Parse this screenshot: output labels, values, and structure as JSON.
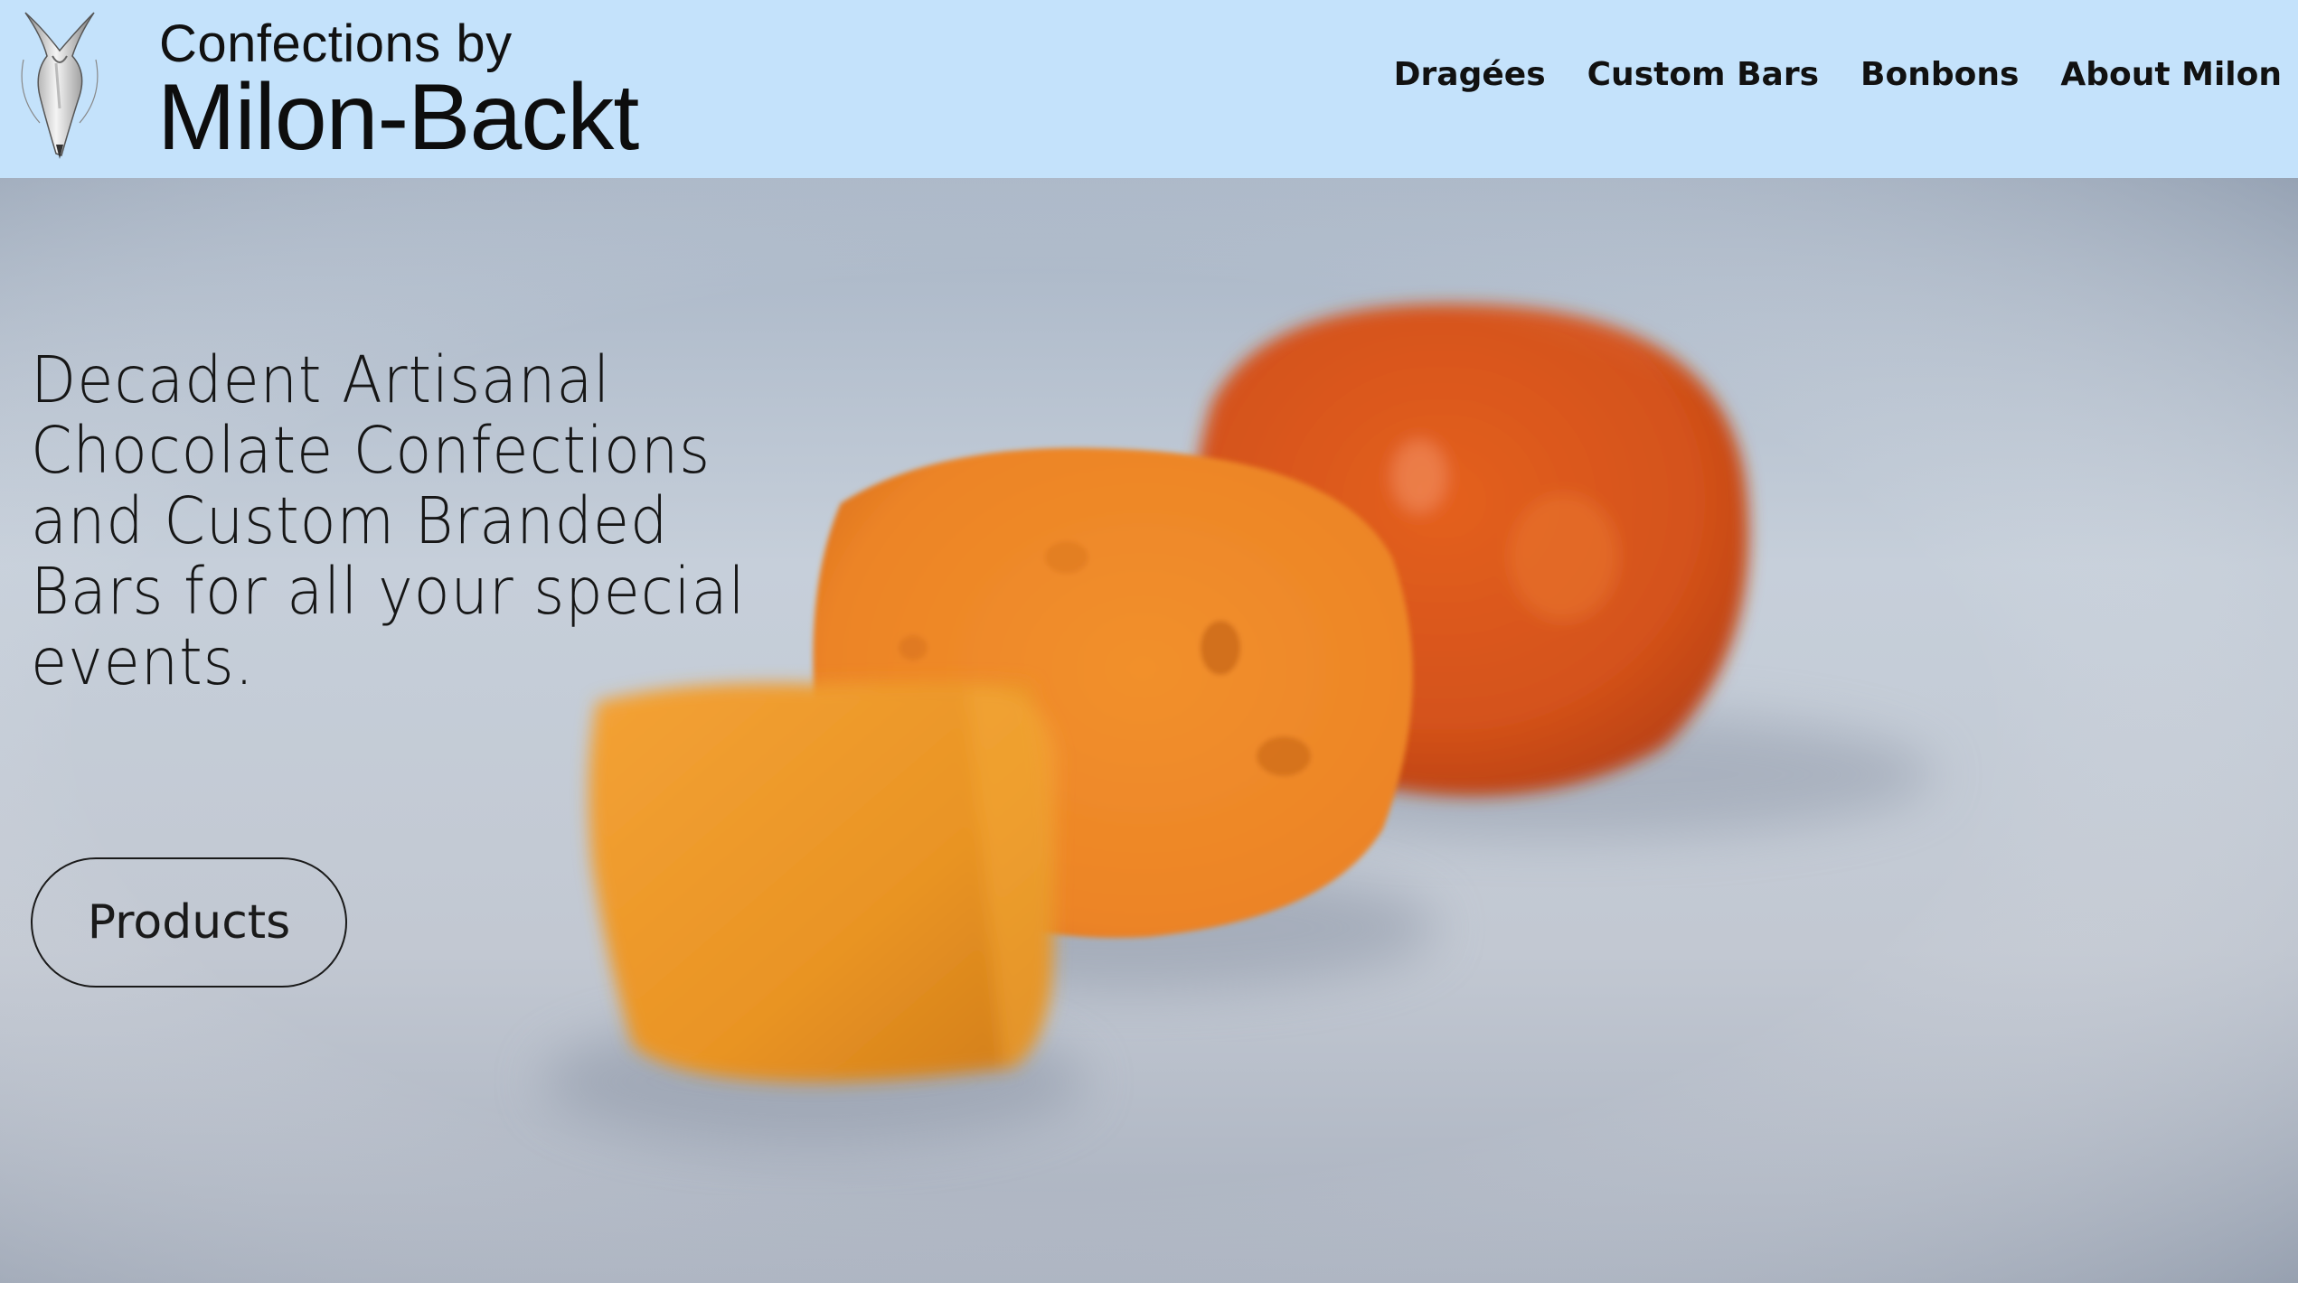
{
  "brand": {
    "line1": "Confections by",
    "line2": "Milon-Backt",
    "logo_icon": "piping-bag-icon"
  },
  "nav": {
    "items": [
      {
        "label": "Dragées"
      },
      {
        "label": "Custom Bars"
      },
      {
        "label": "Bonbons"
      },
      {
        "label": "About Milon"
      }
    ]
  },
  "hero": {
    "headline": "Decadent Artisanal Chocolate Confections and Custom Branded Bars for all your special events.",
    "cta_label": "Products",
    "image": "blurred-orange-confections-photo"
  },
  "colors": {
    "header_bg": "#c4e2fb",
    "hero_bg": "#b8c2d0",
    "accent_orange": "#e87a1a",
    "text": "#111111"
  }
}
